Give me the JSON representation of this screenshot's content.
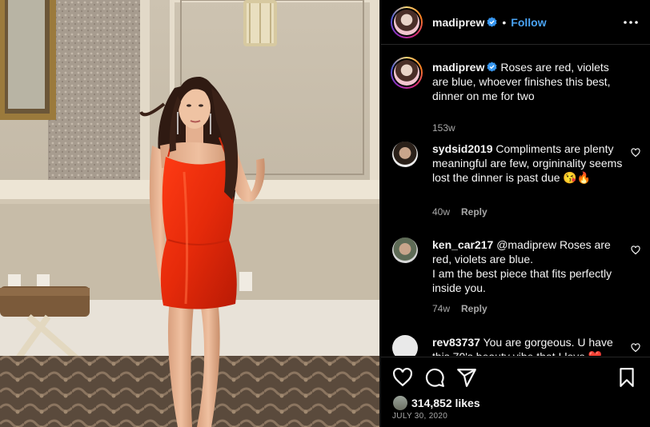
{
  "post": {
    "username": "madiprew",
    "follow_label": "Follow",
    "separator": "•"
  },
  "caption": {
    "username": "madiprew",
    "text": "Roses are red, violets are blue, whoever finishes this best, dinner on me for two",
    "time": "153w"
  },
  "comments": [
    {
      "username": "sydsid2019",
      "text": "Compliments are plenty meaningful are few, orgininality seems lost the dinner is past due 😘🔥",
      "time": "40w",
      "reply_label": "Reply"
    },
    {
      "username": "ken_car217",
      "text": "@madiprew Roses are red, violets are blue.",
      "text2": "I am the best piece that fits perfectly inside you.",
      "time": "74w",
      "reply_label": "Reply"
    },
    {
      "username": "rev83737",
      "text": "You are gorgeous. U have this 70's beauty vibe that I love ❤️"
    }
  ],
  "likes": {
    "text": "314,852 likes"
  },
  "date": "JULY 30, 2020",
  "icons": [
    "verified-badge-icon",
    "more-options-icon",
    "heart-icon",
    "comment-icon",
    "share-icon",
    "bookmark-icon",
    "small-heart-icon"
  ],
  "colors": {
    "follow": "#4aa3f3",
    "verified": "#3897f0",
    "background": "#000000",
    "muted": "#a8a8a8"
  }
}
